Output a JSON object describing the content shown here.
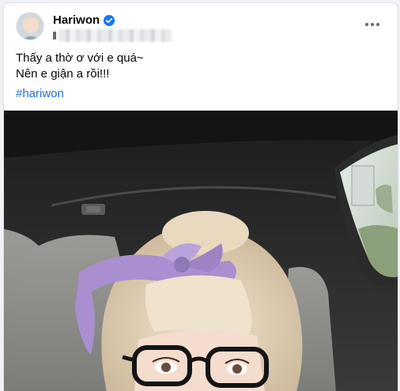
{
  "post": {
    "author": "Hariwon",
    "caption_line1": "Thấy a thờ ơ với e quá~",
    "caption_line2": "Nên e giận a rồi!!!",
    "hashtag": "#hariwon"
  },
  "icons": {
    "verified": "verified-badge-icon",
    "more": "more-options-icon",
    "audience": "audience-icon"
  },
  "colors": {
    "accent": "#1877f2",
    "hashtag": "#216fdb",
    "text": "#050505",
    "headband": "#a98fcf"
  }
}
